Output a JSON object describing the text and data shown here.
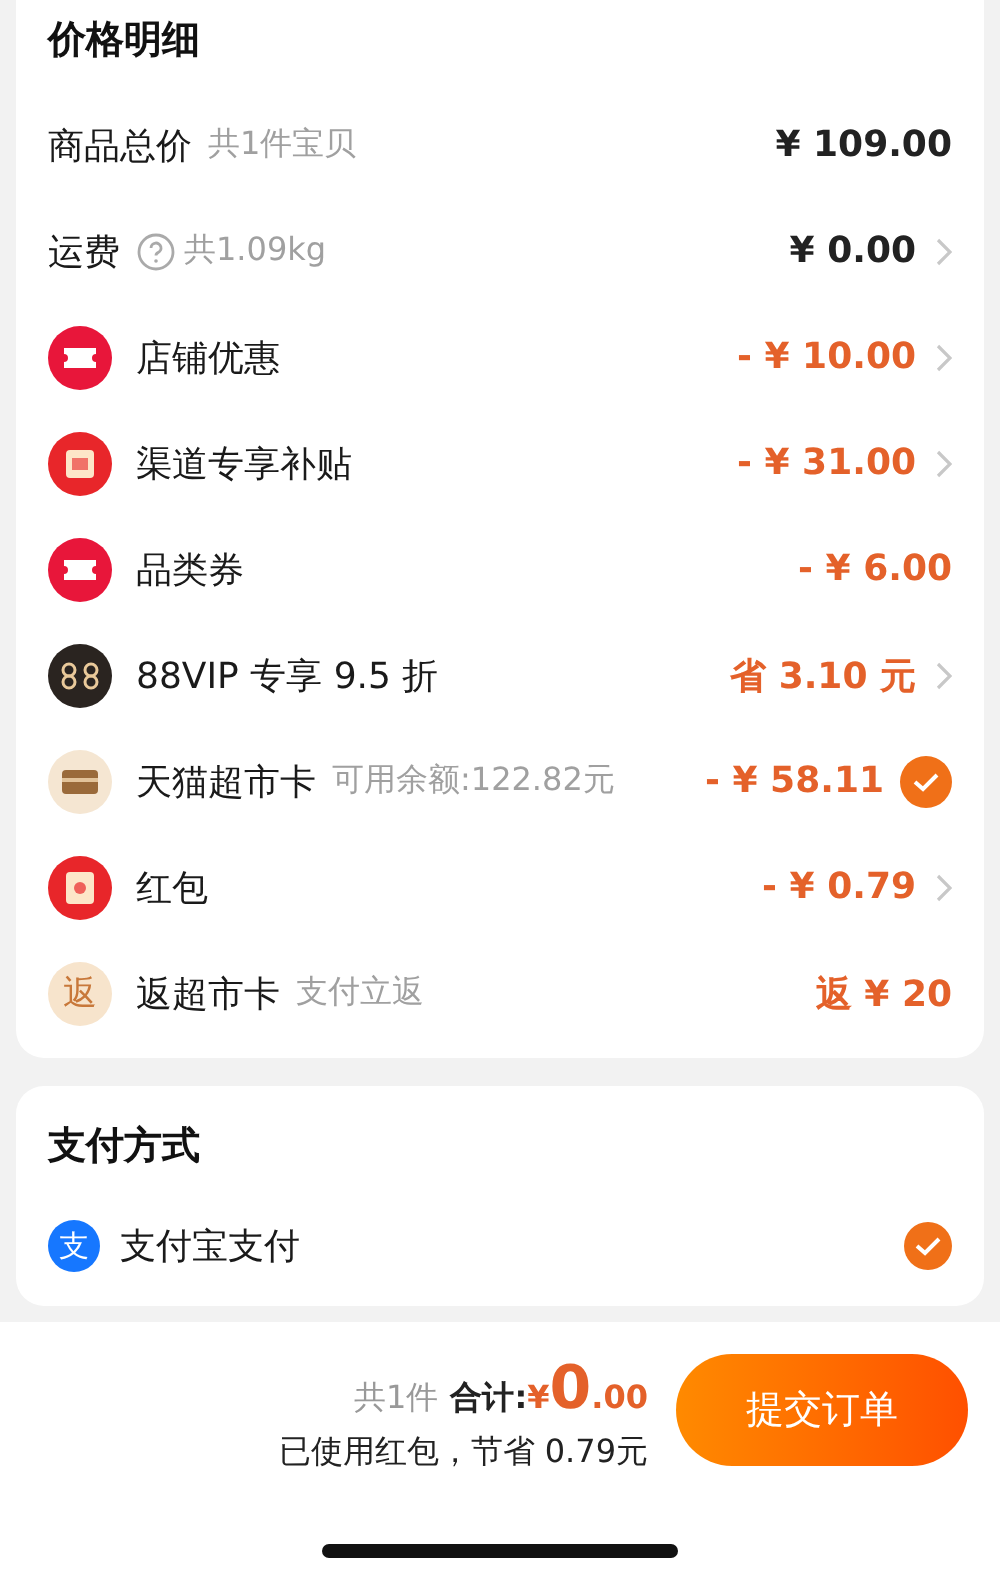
{
  "price_detail": {
    "title": "价格明细",
    "rows": [
      {
        "kind": "none",
        "label": "商品总价",
        "note": "共1件宝贝",
        "value": "¥ 109.00",
        "discount": false,
        "arrow": false,
        "checked": false
      },
      {
        "kind": "help",
        "label": "运费",
        "note": "共1.09kg",
        "value": "¥ 0.00",
        "discount": false,
        "arrow": true,
        "checked": false
      },
      {
        "kind": "ticket",
        "label": "店铺优惠",
        "value": "- ¥ 10.00",
        "discount": true,
        "arrow": true,
        "checked": false
      },
      {
        "kind": "subsidy",
        "label": "渠道专享补贴",
        "value": "- ¥ 31.00",
        "discount": true,
        "arrow": true,
        "checked": false
      },
      {
        "kind": "ticket",
        "label": "品类券",
        "value": "- ¥ 6.00",
        "discount": true,
        "arrow": false,
        "checked": false
      },
      {
        "kind": "vip",
        "label": "88VIP 专享 9.5 折",
        "value": "省 3.10 元",
        "discount": true,
        "arrow": true,
        "checked": false
      },
      {
        "kind": "card",
        "label": "天猫超市卡",
        "note": "可用余额:122.82元",
        "value": "- ¥ 58.11",
        "discount": true,
        "arrow": false,
        "checked": true
      },
      {
        "kind": "redpacket",
        "label": "红包",
        "value": "- ¥ 0.79",
        "discount": true,
        "arrow": true,
        "checked": false
      },
      {
        "kind": "return",
        "icon_text": "返",
        "label": "返超市卡",
        "note": "支付立返",
        "value": "返 ¥ 20",
        "discount": true,
        "arrow": false,
        "checked": false
      }
    ]
  },
  "payment": {
    "title": "支付方式",
    "methods": [
      {
        "icon_text": "支",
        "label": "支付宝支付",
        "selected": true
      }
    ]
  },
  "footer": {
    "count": "共1件",
    "total_label": "合计:",
    "currency": "¥",
    "total_int": "0",
    "total_dec": ".00",
    "savings": "已使用红包，节省 0.79元",
    "submit": "提交订单"
  }
}
